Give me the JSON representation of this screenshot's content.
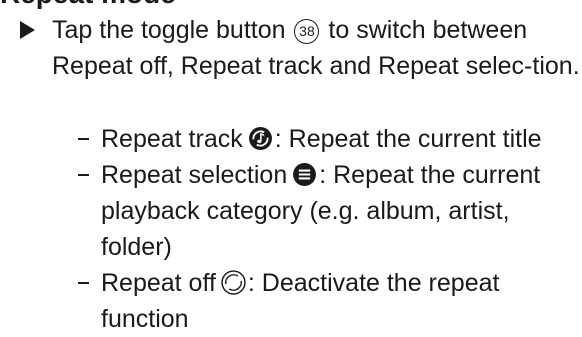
{
  "section": {
    "heading": "Repeat mode"
  },
  "step": {
    "before": "Tap the toggle button ",
    "ref_number": "38",
    "after": " to switch between Repeat off, Repeat track and Repeat selec-tion."
  },
  "options": [
    {
      "label": "Repeat track",
      "icon": "repeat-track-icon",
      "description": ": Repeat the current title"
    },
    {
      "label": "Repeat selection",
      "icon": "repeat-selection-icon",
      "description": ": Repeat the current playback category (e.g. album, artist, folder)"
    },
    {
      "label": "Repeat off",
      "icon": "repeat-off-icon",
      "description": ": Deactivate the repeat function"
    }
  ]
}
